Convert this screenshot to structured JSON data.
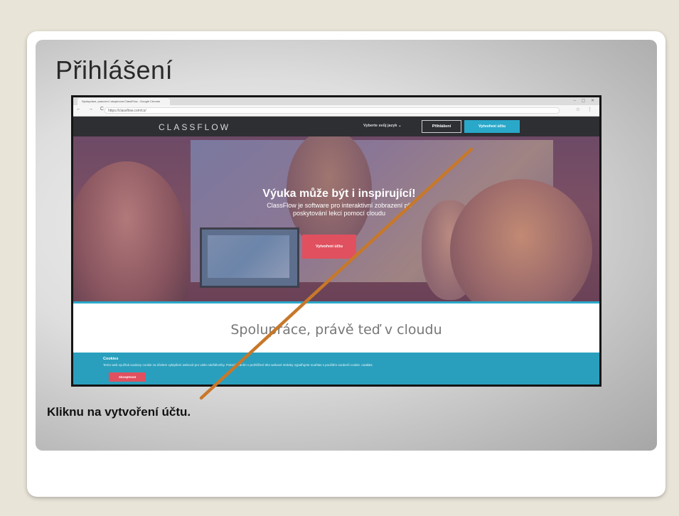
{
  "slide": {
    "title": "Přihlášení",
    "caption": "Kliknu na vytvoření účtu."
  },
  "browser": {
    "tab_title": "Spolupráce, pracovní i skupinová ClassFlow - Google Chrome",
    "window_controls": "– ▢ ✕",
    "nav_buttons": "← → C",
    "url": "https://classflow.com/cs/",
    "menu_icons": "☆ ⋮"
  },
  "site": {
    "brand": "CLASSFLOW",
    "language": "Vyberte svůj jazyk ⌄",
    "login_label": "Přihlášení",
    "signup_label": "Vytvoření účtu",
    "hero_title": "Výuka může být i inspirující!",
    "hero_subtitle": "ClassFlow je software pro interaktivní zobrazení při poskytování lekcí pomocí cloudu",
    "hero_cta": "Vytvoření účtu",
    "tagline": "Spolupráce, právě teď v cloudu",
    "cookie_title": "Cookies",
    "cookie_text": "Tento web využívá soubory cookie za účelem vylepšení webové pro vaše návštěvníky. Pokračováním v prohlížení této webové stránky vyjadřujete souhlas s použitím souborů cookie.",
    "cookie_link": "cookies",
    "cookie_button": "Akceptovat"
  },
  "colors": {
    "accent": "#2aa8c9",
    "cta": "#e0505f",
    "arrow": "#c7782a"
  }
}
